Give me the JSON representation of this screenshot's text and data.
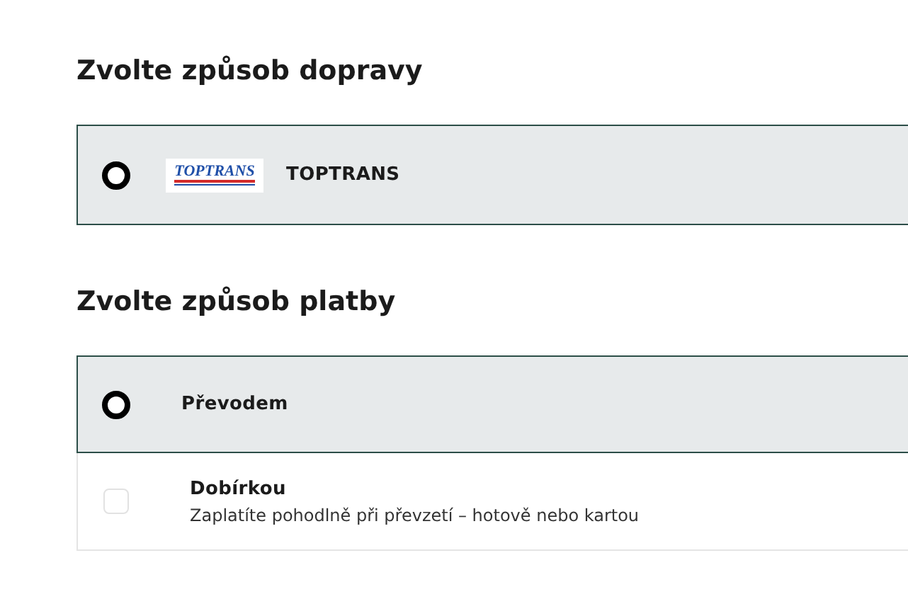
{
  "shipping": {
    "heading": "Zvolte způsob dopravy",
    "options": [
      {
        "label": "TOPTRANS",
        "logo_text": "TOPTRANS",
        "selected": true
      }
    ]
  },
  "payment": {
    "heading": "Zvolte způsob platby",
    "options": [
      {
        "label": "Převodem",
        "selected": true
      },
      {
        "label": "Dobírkou",
        "description": "Zaplatíte pohodlně při převzetí – hotově nebo kartou",
        "selected": false
      }
    ]
  }
}
